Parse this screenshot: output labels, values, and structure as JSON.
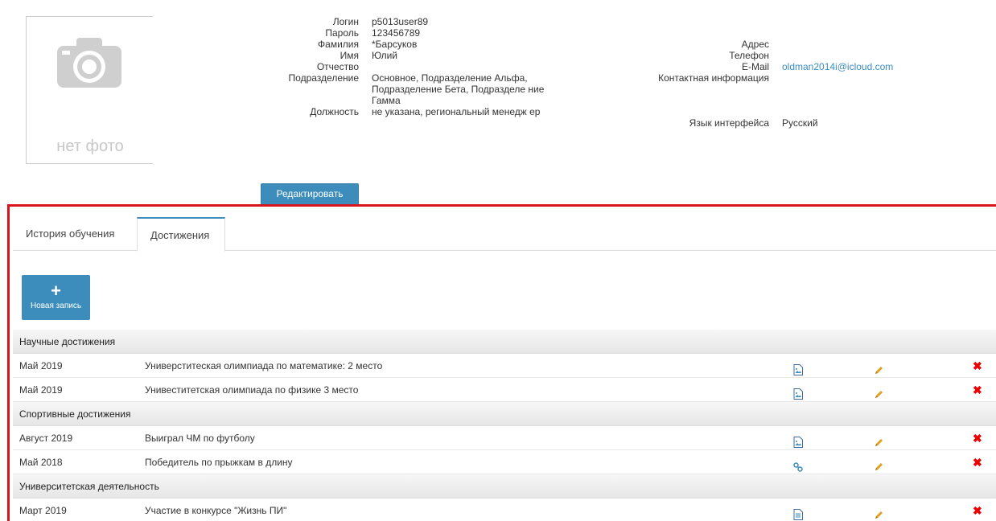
{
  "profile": {
    "no_photo": "нет фото",
    "left_fields": [
      {
        "label": "Логин",
        "value": "p5013user89"
      },
      {
        "label": "Пароль",
        "value": "123456789"
      },
      {
        "label": "Фамилия",
        "value": "*Барсуков"
      },
      {
        "label": "Имя",
        "value": "Юлий"
      },
      {
        "label": "Отчество",
        "value": ""
      },
      {
        "label": "Подразделение",
        "value": "Основное, Подразделение Альфа, Подразделение Бета, Подразделе ние Гамма"
      },
      {
        "label": "Должность",
        "value": "не указана, региональный менедж ер"
      }
    ],
    "right_fields": [
      {
        "label": "Адрес",
        "value": ""
      },
      {
        "label": "Телефон",
        "value": ""
      },
      {
        "label": "E-Mail",
        "value": "oldman2014i@icloud.com"
      },
      {
        "label": "Контактная информация",
        "value": ""
      },
      {
        "label": "Язык интерфейса",
        "value": "Русский"
      }
    ],
    "edit_button": "Редактировать"
  },
  "tabs": [
    {
      "label": "История обучения"
    },
    {
      "label": "Достижения"
    }
  ],
  "new_entry_button": "Новая запись",
  "groups": [
    {
      "title": "Научные достижения",
      "rows": [
        {
          "date": "Май 2019",
          "title": "Универститеская олимпиада по математике: 2 место",
          "attachment": "image-file-icon"
        },
        {
          "date": "Май 2019",
          "title": "Унивеститетская олимпиада по физике 3 место",
          "attachment": "image-file-icon"
        }
      ]
    },
    {
      "title": "Спортивные достижения",
      "rows": [
        {
          "date": "Август 2019",
          "title": "Выиграл ЧМ по футболу",
          "attachment": "image-file-icon"
        },
        {
          "date": "Май 2018",
          "title": "Победитель по прыжкам в длину",
          "attachment": "link-icon"
        }
      ]
    },
    {
      "title": "Университетская деятельность",
      "rows": [
        {
          "date": "Март 2019",
          "title": "Участие в конкурсе \"Жизнь ПИ\"",
          "attachment": "document-icon"
        }
      ]
    }
  ],
  "colors": {
    "accent": "#3c8dbc",
    "highlight_frame": "#d8141c",
    "delete": "#e00000",
    "edit_pencil": "#e0a020",
    "link": "#3b8dbd"
  }
}
